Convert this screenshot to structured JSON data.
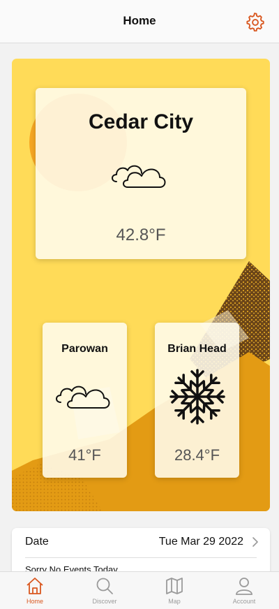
{
  "header": {
    "title": "Home",
    "settings_icon": "gear-icon"
  },
  "colors": {
    "accent": "#d9571f",
    "hero_bg": "#ffdb58",
    "mountain": "#e39b14"
  },
  "locations": {
    "main": {
      "name": "Cedar City",
      "temp": "42.8°F",
      "condition_icon": "cloudy-icon"
    },
    "small": [
      {
        "name": "Parowan",
        "temp": "41°F",
        "condition_icon": "cloudy-icon"
      },
      {
        "name": "Brian Head",
        "temp": "28.4°F",
        "condition_icon": "snowflake-icon"
      }
    ]
  },
  "events": {
    "date_label": "Date",
    "date_value": "Tue Mar 29 2022",
    "empty_message": "Sorry No Events Today"
  },
  "tabs": [
    {
      "label": "Home",
      "icon": "home-icon",
      "active": true
    },
    {
      "label": "Discover",
      "icon": "search-icon",
      "active": false
    },
    {
      "label": "Map",
      "icon": "map-icon",
      "active": false
    },
    {
      "label": "Account",
      "icon": "user-icon",
      "active": false
    }
  ]
}
